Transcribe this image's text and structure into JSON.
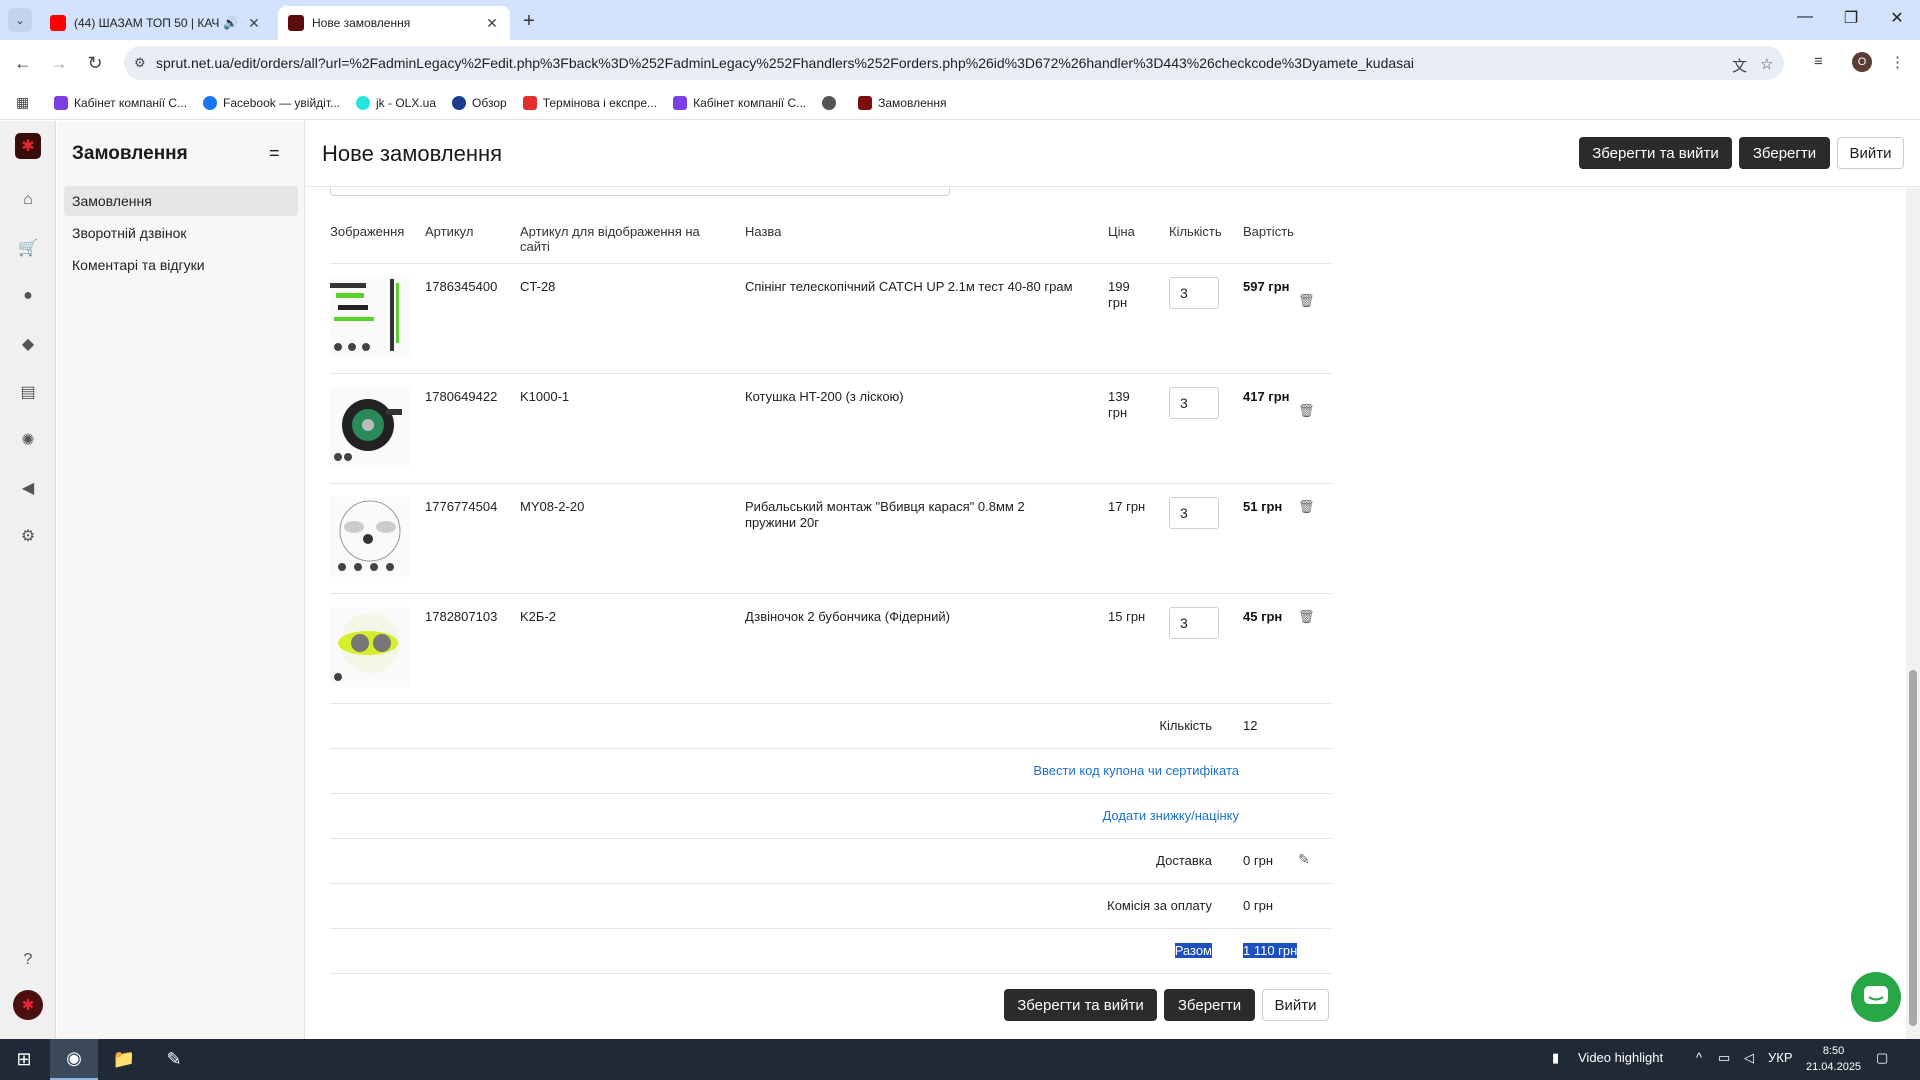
{
  "browser": {
    "tabs": [
      {
        "title": "(44) ШАЗАМ ТОП 50 | КАЧ",
        "active": false
      },
      {
        "title": "Нове замовлення",
        "active": true
      }
    ],
    "url": "sprut.net.ua/edit/orders/all?url=%2FadminLegacy%2Fedit.php%3Fback%3D%252FadminLegacy%252Fhandlers%252Forders.php%26id%3D672%26handler%3D443%26checkcode%3Dyamete_kudasai",
    "profile_initial": "О",
    "bookmarks": [
      {
        "label": "Кабінет компанії С...",
        "icon_color": "#7b3fe4"
      },
      {
        "label": "Facebook — увійдіт...",
        "icon_color": "#1877f2"
      },
      {
        "label": "jk - OLX.ua",
        "icon_color": "#23e5db"
      },
      {
        "label": "Обзор",
        "icon_color": "#1a3b8f"
      },
      {
        "label": "Термінова і експре...",
        "icon_color": "#e52e2e"
      },
      {
        "label": "Кабінет компанії С...",
        "icon_color": "#7b3fe4"
      },
      {
        "label": "",
        "icon_color": "#555555"
      },
      {
        "label": "Замовлення",
        "icon_color": "#7a0f0f"
      }
    ]
  },
  "sidebar": {
    "title": "Замовлення",
    "items": [
      {
        "label": "Замовлення",
        "active": true
      },
      {
        "label": "Зворотній дзвінок",
        "active": false
      },
      {
        "label": "Коментарі та відгуки",
        "active": false
      }
    ]
  },
  "header": {
    "title": "Нове замовлення",
    "save_exit_label": "Зберегти та вийти",
    "save_label": "Зберегти",
    "exit_label": "Вийти"
  },
  "table": {
    "columns": [
      "Зображення",
      "Артикул",
      "Артикул для відображення на сайті",
      "Назва",
      "Ціна",
      "Кількість",
      "Вартість"
    ],
    "rows": [
      {
        "sku": "1786345400",
        "site_sku": "CT-28",
        "name": "Спінінг телескопічний CATCH UP 2.1м тест 40-80 грам",
        "price": "199 грн",
        "qty": "3",
        "total": "597 грн"
      },
      {
        "sku": "1780649422",
        "site_sku": "K1000-1",
        "name": "Котушка HT-200 (з ліскою)",
        "price": "139 грн",
        "qty": "3",
        "total": "417 грн"
      },
      {
        "sku": "1776774504",
        "site_sku": "MY08-2-20",
        "name": "Рибальський монтаж \"Вбивця карася\" 0.8мм 2 пружини 20г",
        "price": "17 грн",
        "qty": "3",
        "total": "51 грн"
      },
      {
        "sku": "1782807103",
        "site_sku": "K2Б-2",
        "name": "Дзвіночок 2 бубончика (Фідерний)",
        "price": "15 грн",
        "qty": "3",
        "total": "45 грн"
      }
    ]
  },
  "summary": {
    "quantity_label": "Кількість",
    "quantity_value": "12",
    "coupon_link": "Ввести код купона чи сертифіката",
    "discount_link": "Додати знижку/націнку",
    "delivery_label": "Доставка",
    "delivery_value": "0 грн",
    "commission_label": "Комісія за оплату",
    "commission_value": "0 грн",
    "total_label": "Разом",
    "total_value": "1 110 грн"
  },
  "footer_buttons": {
    "save_exit_label": "Зберегти та вийти",
    "save_label": "Зберегти",
    "exit_label": "Вийти"
  },
  "taskbar": {
    "video_highlight": "Video highlight",
    "lang": "УКР",
    "time": "8:50",
    "date": "21.04.2025"
  },
  "colors": {
    "accent_dark": "#2b2b2b",
    "link": "#1a73c8",
    "chat": "#27a745"
  }
}
